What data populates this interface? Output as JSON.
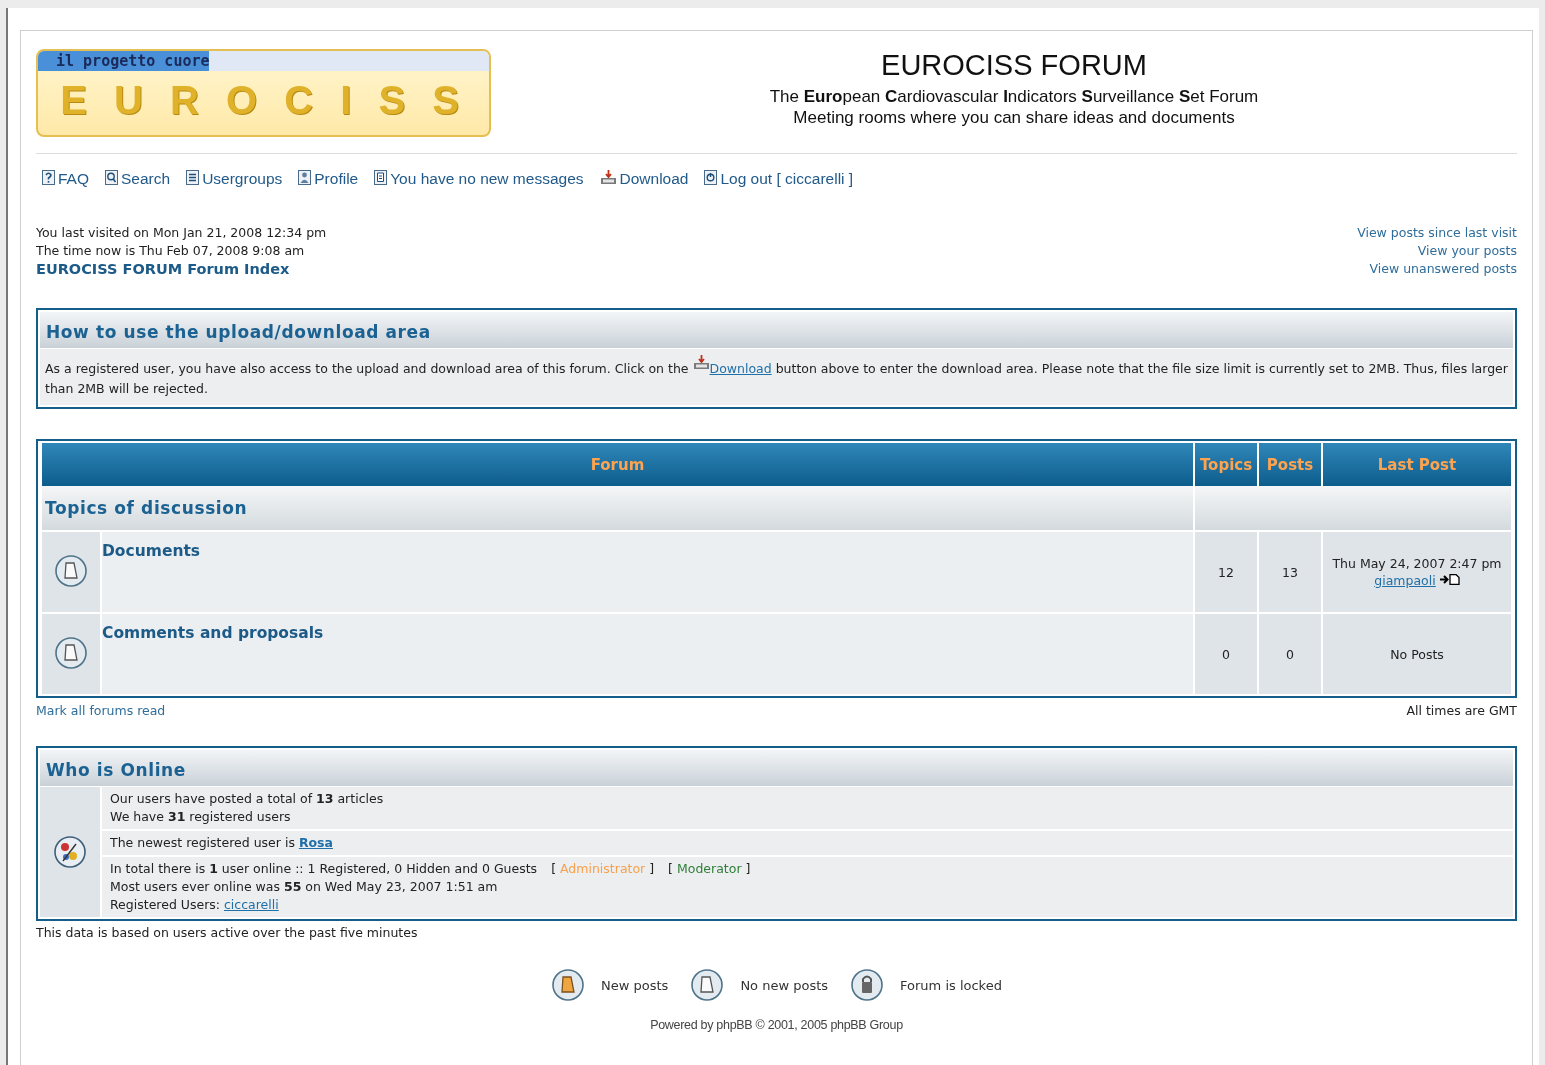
{
  "header": {
    "logo": {
      "tagline": "il progetto cuore",
      "wordmark": "E U R O C I S S"
    },
    "title": "EUROCISS FORUM",
    "subtitle": "The **Euro**pean **C**ardiovascular **I**ndicators **S**urveillance **S**et Forum",
    "tagline": "Meeting rooms where you can share ideas and documents"
  },
  "nav": [
    {
      "kind": "faq",
      "label": "FAQ"
    },
    {
      "kind": "search",
      "label": "Search"
    },
    {
      "kind": "groups",
      "label": "Usergroups"
    },
    {
      "kind": "profile",
      "label": "Profile"
    },
    {
      "kind": "messages",
      "label": "You have no new messages"
    },
    {
      "kind": "download",
      "label": "Download"
    },
    {
      "kind": "logout",
      "label": "Log out [ ciccarelli ]"
    }
  ],
  "visit_info": {
    "last_visit": "You last visited on Mon Jan 21, 2008 12:34 pm",
    "time_now": "The time now is Thu Feb 07, 2008 9:08 am",
    "index_link": "EUROCISS FORUM Forum Index"
  },
  "quick_links": [
    "View posts since last visit",
    "View your posts",
    "View unanswered posts"
  ],
  "notice": {
    "title": "How to use the upload/download area",
    "text_before": "As a registered user, you have also access to the upload and download area of this forum. Click on the",
    "link": "Download",
    "text_after": "button above to enter the download area. Please note that the file size limit is currently set to 2MB. Thus, files larger than 2MB will be rejected."
  },
  "forum_table": {
    "columns": [
      "Forum",
      "Topics",
      "Posts",
      "Last Post"
    ],
    "category": "Topics of discussion",
    "rows": [
      {
        "unread": false,
        "name": "Documents",
        "topics": "12",
        "posts": "13",
        "last_post": {
          "date": "Thu May 24, 2007 2:47 pm",
          "author": "giampaoli"
        }
      },
      {
        "unread": false,
        "name": "Comments and proposals",
        "topics": "0",
        "posts": "0",
        "last_post": {
          "text": "No Posts"
        }
      }
    ]
  },
  "mark_read": "Mark all forums read",
  "timezone": "All times are GMT",
  "who_is_online": {
    "title": "Who is Online",
    "stats": [
      "Our users have posted a total of **13** articles",
      "We have **31** registered users"
    ],
    "newest_user": {
      "text": "The newest registered user is",
      "link": "Rosa"
    },
    "online": "In total there is **1** user online :: 1 Registered, 0 Hidden and 0 Guests",
    "roles": [
      {
        "open": "[",
        "label": "Administrator",
        "close": "]",
        "color": "#f7a14c"
      },
      {
        "open": "[",
        "label": "Moderator",
        "close": "]",
        "color": "#2f7f3a"
      }
    ],
    "record": "Most users ever online was **55** on Wed May 23, 2007 1:51 am",
    "registered_users": {
      "label": "Registered Users:",
      "link": "ciccarelli"
    }
  },
  "online_note": "This data is based on users active over the past five minutes",
  "legend": [
    {
      "kind": "new",
      "label": "New posts"
    },
    {
      "kind": "no_new",
      "label": "No new posts"
    },
    {
      "kind": "locked",
      "label": "Forum is locked"
    }
  ],
  "footer": "Powered by phpBB © 2001, 2005 phpBB Group"
}
